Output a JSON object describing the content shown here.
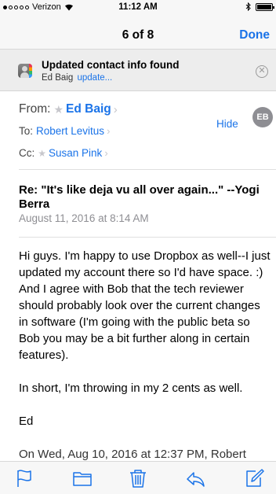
{
  "status_bar": {
    "carrier": "Verizon",
    "time": "11:12 AM"
  },
  "nav": {
    "title": "6 of 8",
    "done_label": "Done"
  },
  "banner": {
    "title": "Updated contact info found",
    "contact_name": "Ed Baig",
    "link_label": "update..."
  },
  "header": {
    "from_label": "From:",
    "from_name": "Ed Baig",
    "to_label": "To:",
    "to_name": "Robert Levitus",
    "cc_label": "Cc:",
    "cc_name": "Susan Pink",
    "hide_label": "Hide",
    "avatar_initials": "EB"
  },
  "message": {
    "subject": "Re: \"It's like deja vu all over again...\" --Yogi Berra",
    "date": "August 11, 2016 at 8:14 AM",
    "paragraphs": [
      "Hi guys. I'm happy to use Dropbox as well--I just updated my account there so I'd have space. :) And I agree with Bob that the tech reviewer should probably look over the current changes in software (I'm going with the public beta so Bob you may be a bit further along in certain features).",
      "In short, I'm throwing in my 2 cents as well.",
      "Ed"
    ],
    "quote_line": "On Wed, Aug 10, 2016 at 12:37 PM, Robert"
  },
  "toolbar": {
    "icons": [
      "flag-icon",
      "folder-icon",
      "trash-icon",
      "reply-icon",
      "compose-icon"
    ]
  },
  "colors": {
    "accent": "#1a73e8",
    "bar_bg": "#f7f7f7",
    "banner_bg": "#ededed",
    "muted": "#8e8e93"
  }
}
